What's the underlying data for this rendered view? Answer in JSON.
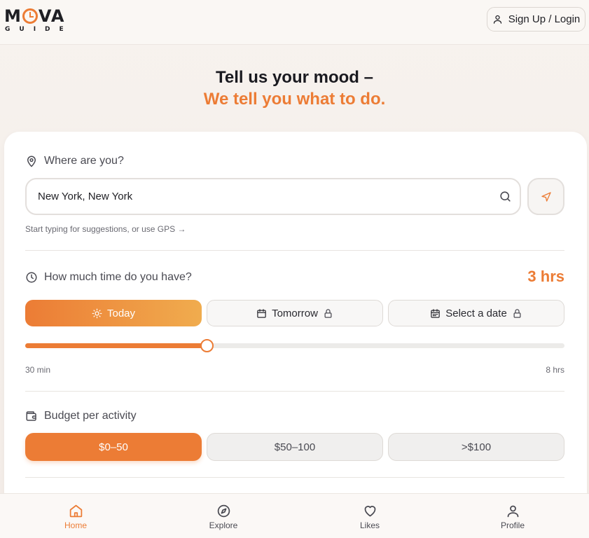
{
  "brand": {
    "word_left": "M",
    "word_right": "VA",
    "sub": "GUIDE",
    "accent": "#ec7c35"
  },
  "header": {
    "signup_label": "Sign Up / Login"
  },
  "hero": {
    "line1": "Tell us your mood –",
    "line2": "We tell you what to do."
  },
  "location": {
    "label": "Where are you?",
    "value": "New York, New York",
    "hint": "Start typing for suggestions, or use GPS →"
  },
  "time": {
    "label": "How much time do you have?",
    "value_text": "3 hrs",
    "options": [
      {
        "label": "Today",
        "selected": true,
        "locked": false
      },
      {
        "label": "Tomorrow",
        "selected": false,
        "locked": true
      },
      {
        "label": "Select a date",
        "selected": false,
        "locked": true
      }
    ],
    "slider": {
      "min_label": "30 min",
      "max_label": "8 hrs",
      "fraction": 0.337
    }
  },
  "budget": {
    "label": "Budget per activity",
    "options": [
      {
        "label": "$0–50",
        "selected": true
      },
      {
        "label": "$50–100",
        "selected": false
      },
      {
        "label": ">$100",
        "selected": false
      }
    ]
  },
  "nav": {
    "items": [
      {
        "label": "Home",
        "icon": "home-icon",
        "active": true
      },
      {
        "label": "Explore",
        "icon": "compass-icon",
        "active": false
      },
      {
        "label": "Likes",
        "icon": "heart-icon",
        "active": false
      },
      {
        "label": "Profile",
        "icon": "user-icon",
        "active": false
      }
    ]
  }
}
